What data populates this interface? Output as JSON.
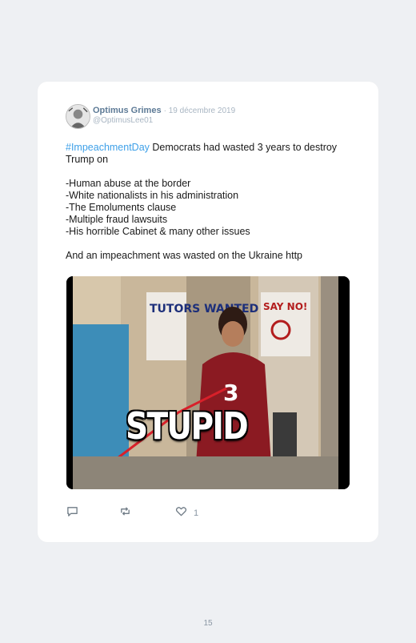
{
  "tweet": {
    "author_name": "Optimus Grimes",
    "date": "· 19 décembre 2019",
    "handle": "@OptimusLee01",
    "hashtag": "#ImpeachmentDay",
    "line1_rest": " Democrats had wasted 3 years to destroy Trump on",
    "list": [
      "-Human abuse at the border",
      "-White nationalists in his administration",
      "-The Emoluments clause",
      "-Multiple fraud lawsuits",
      "-His horrible Cabinet & many other issues"
    ],
    "closing": "And an impeachment was wasted on the Ukraine http",
    "media_caption": "STUPID",
    "media_signs": [
      "TUTORS WANTED",
      "SAY NO!",
      "3"
    ],
    "like_count": "1"
  },
  "icons": [
    "reply-icon",
    "retweet-icon",
    "heart-icon"
  ],
  "page": {
    "number": "15"
  }
}
